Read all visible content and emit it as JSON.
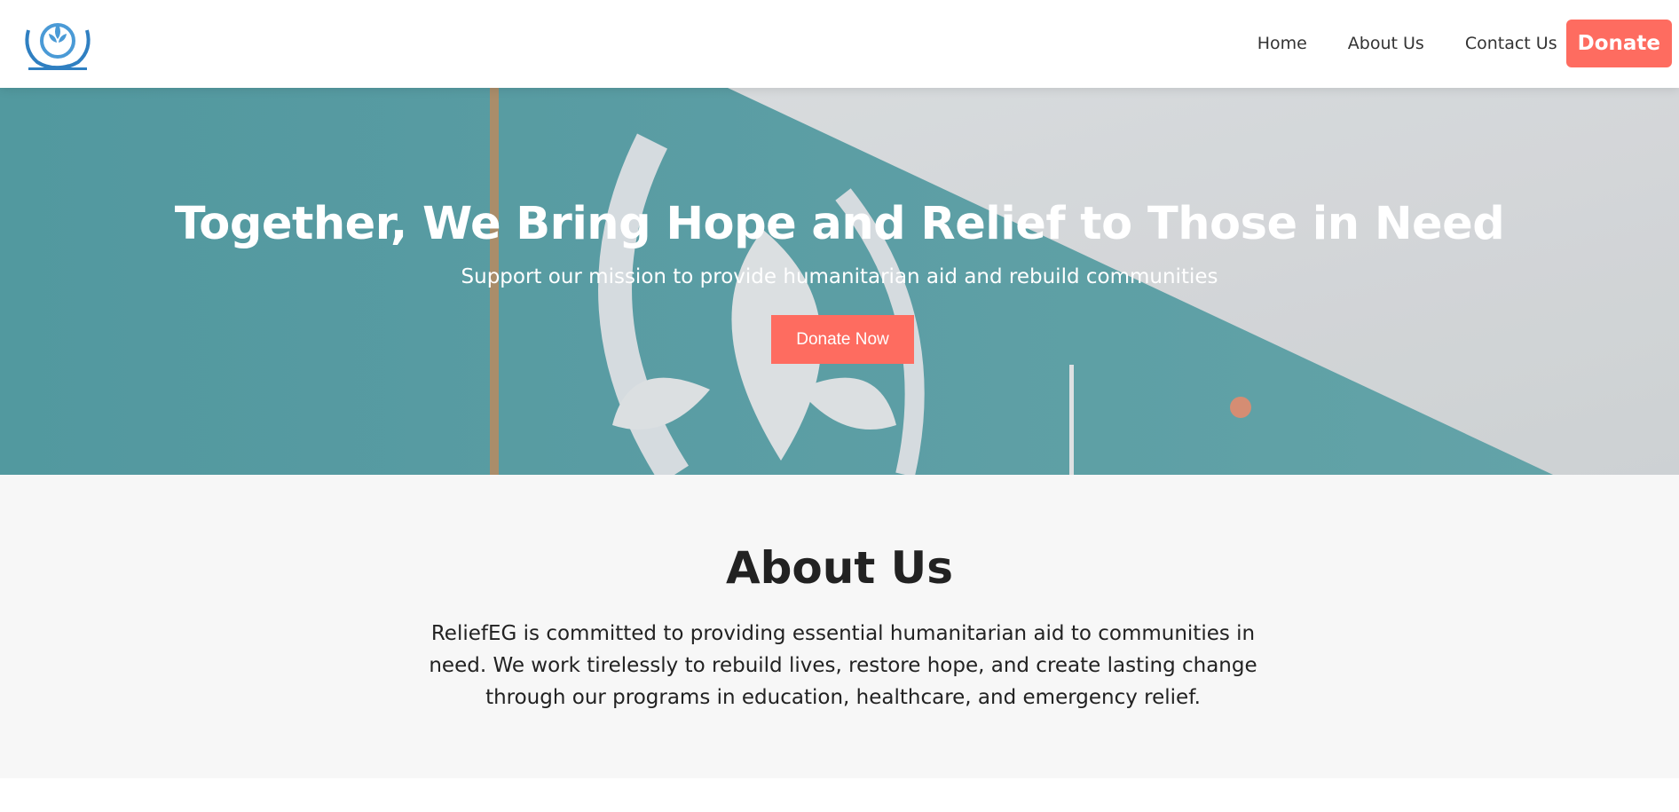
{
  "header": {
    "logo_icon": "relief-org-emblem-icon",
    "nav": {
      "home": "Home",
      "about": "About Us",
      "contact": "Contact Us",
      "donate": "Donate"
    }
  },
  "hero": {
    "title": "Together, We Bring Hope and Relief to Those in Need",
    "subtitle": "Support our mission to provide humanitarian aid and rebuild communities",
    "button": "Donate Now"
  },
  "about": {
    "title": "About Us",
    "text": "ReliefEG is committed to providing essential humanitarian aid to communities in need. We work tirelessly to rebuild lives, restore hope, and create lasting change through our programs in education, healthcare, and emergency relief."
  },
  "colors": {
    "accent": "#fe6c60",
    "banner_teal": "#5fa9b0",
    "section_bg": "#f7f7f7"
  }
}
